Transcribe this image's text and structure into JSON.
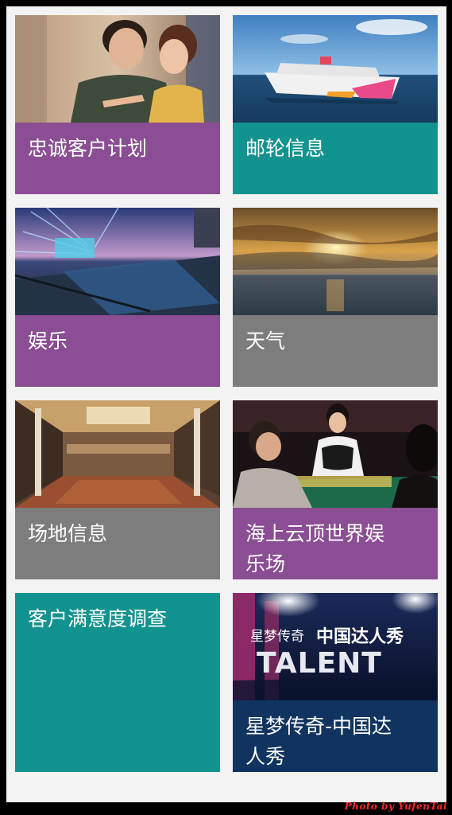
{
  "tiles": [
    {
      "id": "loyalty",
      "label": "忠诚客户计划",
      "image": "couple-pointing-photo"
    },
    {
      "id": "cruise",
      "label": "邮轮信息",
      "image": "cruise-ship-photo"
    },
    {
      "id": "entertainment",
      "label": "娱乐",
      "image": "pool-deck-night-photo"
    },
    {
      "id": "weather",
      "label": "天气",
      "image": "sunset-sea-photo"
    },
    {
      "id": "venue",
      "label": "场地信息",
      "image": "ballroom-photo"
    },
    {
      "id": "casino",
      "label": "海上云顶世界娱乐场",
      "image": "casino-dealer-photo"
    },
    {
      "id": "survey",
      "label": "客户满意度调查",
      "image": ""
    },
    {
      "id": "talent",
      "label": "星梦传奇-中国达人秀",
      "image": "talent-show-poster"
    }
  ],
  "poster": {
    "brand": "星梦传奇",
    "title": "中国达人秀",
    "logo": "TALENT"
  },
  "watermark": "Photo by YufenTai",
  "colors": {
    "purple": "#8b4d93",
    "teal": "#12938f",
    "gray": "#7d7d7d",
    "navy": "#10345f"
  }
}
